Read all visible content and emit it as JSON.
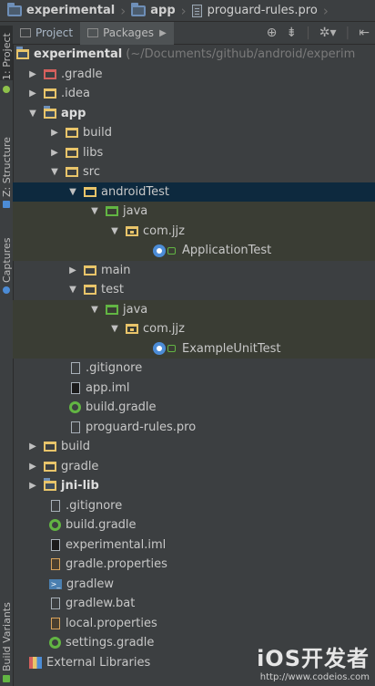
{
  "breadcrumb": [
    "experimental",
    "app",
    "proguard-rules.pro"
  ],
  "strip": {
    "project": "1: Project",
    "structure": "Z: Structure",
    "captures": "Captures",
    "variants": "Build Variants"
  },
  "toolbar": {
    "project_tab": "Project",
    "packages_tab": "Packages"
  },
  "tree": {
    "root": {
      "name": "experimental",
      "path": "(~/Documents/github/android/experim"
    },
    "rows": [
      {
        "label": ".gradle"
      },
      {
        "label": ".idea"
      },
      {
        "label": "app"
      },
      {
        "label": "build"
      },
      {
        "label": "libs"
      },
      {
        "label": "src"
      },
      {
        "label": "androidTest"
      },
      {
        "label": "java"
      },
      {
        "label": "com.jjz"
      },
      {
        "label": "ApplicationTest"
      },
      {
        "label": "main"
      },
      {
        "label": "test"
      },
      {
        "label": "java"
      },
      {
        "label": "com.jjz"
      },
      {
        "label": "ExampleUnitTest"
      },
      {
        "label": ".gitignore"
      },
      {
        "label": "app.iml"
      },
      {
        "label": "build.gradle"
      },
      {
        "label": "proguard-rules.pro"
      },
      {
        "label": "build"
      },
      {
        "label": "gradle"
      },
      {
        "label": "jni-lib"
      },
      {
        "label": ".gitignore"
      },
      {
        "label": "build.gradle"
      },
      {
        "label": "experimental.iml"
      },
      {
        "label": "gradle.properties"
      },
      {
        "label": "gradlew"
      },
      {
        "label": "gradlew.bat"
      },
      {
        "label": "local.properties"
      },
      {
        "label": "settings.gradle"
      },
      {
        "label": "External Libraries"
      }
    ]
  },
  "watermark": {
    "brand": "iOS开发者",
    "url": "http://www.codeios.com"
  }
}
